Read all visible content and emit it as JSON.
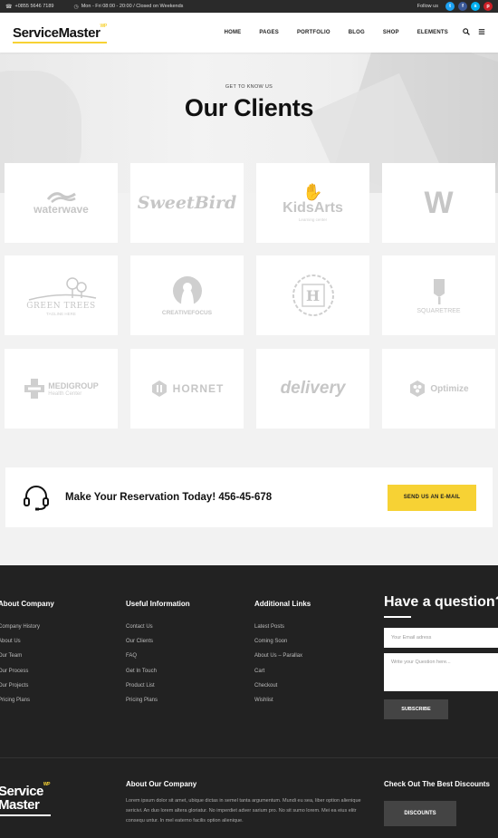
{
  "topbar": {
    "phone": "+0855 5646 7189",
    "hours": "Mon - Fri 08:00 - 20:00 / Closed on Weekends",
    "follow_label": "Follow us",
    "social": [
      {
        "name": "twitter",
        "glyph": "t",
        "color": "#1da1f2"
      },
      {
        "name": "facebook",
        "glyph": "f",
        "color": "#3b5998"
      },
      {
        "name": "skype",
        "glyph": "s",
        "color": "#00aff0"
      },
      {
        "name": "pinterest",
        "glyph": "p",
        "color": "#cb2027"
      }
    ]
  },
  "header": {
    "logo": "ServiceMaster",
    "logo_badge": "WP",
    "nav": [
      "HOME",
      "PAGES",
      "PORTFOLIO",
      "BLOG",
      "SHOP",
      "ELEMENTS"
    ]
  },
  "hero": {
    "kicker": "GET TO KNOW US",
    "title": "Our Clients"
  },
  "clients": [
    {
      "name": "waterwave",
      "sub": ""
    },
    {
      "name": "SweetBird",
      "sub": ""
    },
    {
      "name": "KidsArts",
      "sub": "Learning center"
    },
    {
      "name": "W",
      "sub": ""
    },
    {
      "name": "GREEN TREES",
      "sub": "TAGLINE HERE"
    },
    {
      "name": "CREATIVEFOCUS",
      "sub": ""
    },
    {
      "name": "H",
      "sub": ""
    },
    {
      "name": "SQUARETREE",
      "sub": ""
    },
    {
      "name": "MEDIGROUP",
      "sub": "Health Center"
    },
    {
      "name": "HORNET",
      "sub": ""
    },
    {
      "name": "delivery",
      "sub": ""
    },
    {
      "name": "Optimize",
      "sub": ""
    }
  ],
  "reservation": {
    "text": "Make Your Reservation Today! 456-45-678",
    "button": "SEND US AN E-MAIL"
  },
  "footer": {
    "columns": [
      {
        "title": "About Company",
        "items": [
          "Company History",
          "About Us",
          "Our Team",
          "Our Process",
          "Our Projects",
          "Pricing Plans"
        ]
      },
      {
        "title": "Useful Information",
        "items": [
          "Contact Us",
          "Our Clients",
          "FAQ",
          "Get In Touch",
          "Product List",
          "Pricing Plans"
        ]
      },
      {
        "title": "Additional Links",
        "items": [
          "Latest Posts",
          "Coming Soon",
          "About Us – Parallax",
          "Cart",
          "Checkout",
          "Wishlist"
        ]
      }
    ],
    "question": {
      "title": "Have a question?",
      "email_placeholder": "Your Email adress",
      "message_placeholder": "Write your Question here...",
      "button": "SUBSCRIBE"
    },
    "logo_line1": "Service",
    "logo_line2": "Master",
    "logo_badge": "WP",
    "about_title": "About Our Company",
    "about_text": "Lorem ipsum dolor sit amet, ubique dictas in semel tanta argumentum. Mundi eu sea, liber option alienique sericivi. An duo lorem altera gloriatur. No imperdiet adver sarium pro. No sit sumo lorem. Mei ea eius elitr consequ untur. In mel eaterno facilis option alienique.",
    "discount_title": "Check Out The Best Discounts",
    "discount_button": "DISCOUNTS"
  }
}
